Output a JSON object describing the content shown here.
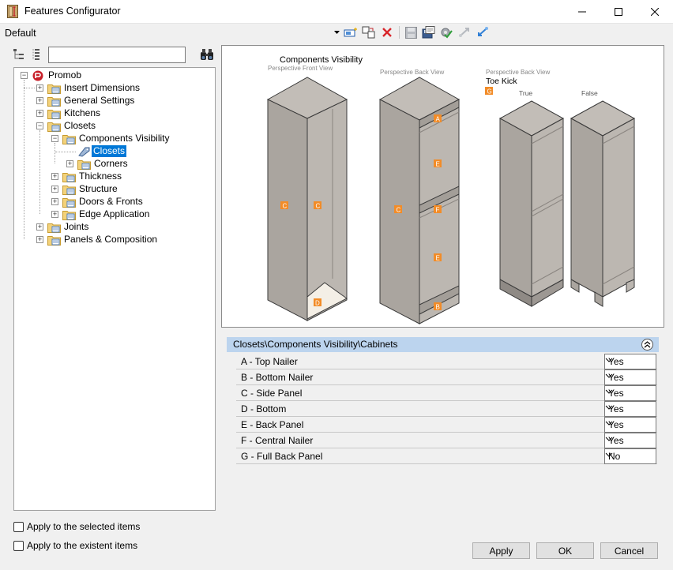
{
  "window": {
    "title": "Features Configurator"
  },
  "toolbar": {
    "configuration": "Default"
  },
  "tree": {
    "search_value": "",
    "nodes": [
      {
        "label": "Promob"
      },
      {
        "label": "Insert Dimensions"
      },
      {
        "label": "General Settings"
      },
      {
        "label": "Kitchens"
      },
      {
        "label": "Closets"
      },
      {
        "label": "Components Visibility"
      },
      {
        "label": "Closets"
      },
      {
        "label": "Corners"
      },
      {
        "label": "Thickness"
      },
      {
        "label": "Structure"
      },
      {
        "label": "Doors & Fronts"
      },
      {
        "label": "Edge Application"
      },
      {
        "label": "Joints"
      },
      {
        "label": "Panels & Composition"
      }
    ]
  },
  "options": {
    "apply_selected": "Apply to the selected items",
    "apply_existent": "Apply to the existent items"
  },
  "preview": {
    "title": "Components Visibility",
    "front_caption": "Perspective Front View",
    "back_caption": "Perspective Back View",
    "toe_caption": "Perspective Back View",
    "toe_title": "Toe Kick",
    "toe_letter": "G",
    "true_label": "True",
    "false_label": "False",
    "markers": {
      "a": "A",
      "b": "B",
      "c": "C",
      "d": "D",
      "e": "E",
      "f": "F"
    }
  },
  "properties": {
    "path": "Closets\\Components Visibility\\Cabinets",
    "rows": [
      {
        "name": "A - Top Nailer",
        "value": "Yes"
      },
      {
        "name": "B - Bottom Nailer",
        "value": "Yes"
      },
      {
        "name": "C - Side Panel",
        "value": "Yes"
      },
      {
        "name": "D - Bottom",
        "value": "Yes"
      },
      {
        "name": "E - Back Panel",
        "value": "Yes"
      },
      {
        "name": "F - Central Nailer",
        "value": "Yes"
      },
      {
        "name": "G - Full Back Panel",
        "value": "No"
      }
    ]
  },
  "buttons": {
    "apply": "Apply",
    "ok": "OK",
    "cancel": "Cancel"
  },
  "colors": {
    "selection": "#0078d7",
    "marker": "#f28c28",
    "header": "#bcd4ee",
    "panel": "#b5b0aa"
  }
}
